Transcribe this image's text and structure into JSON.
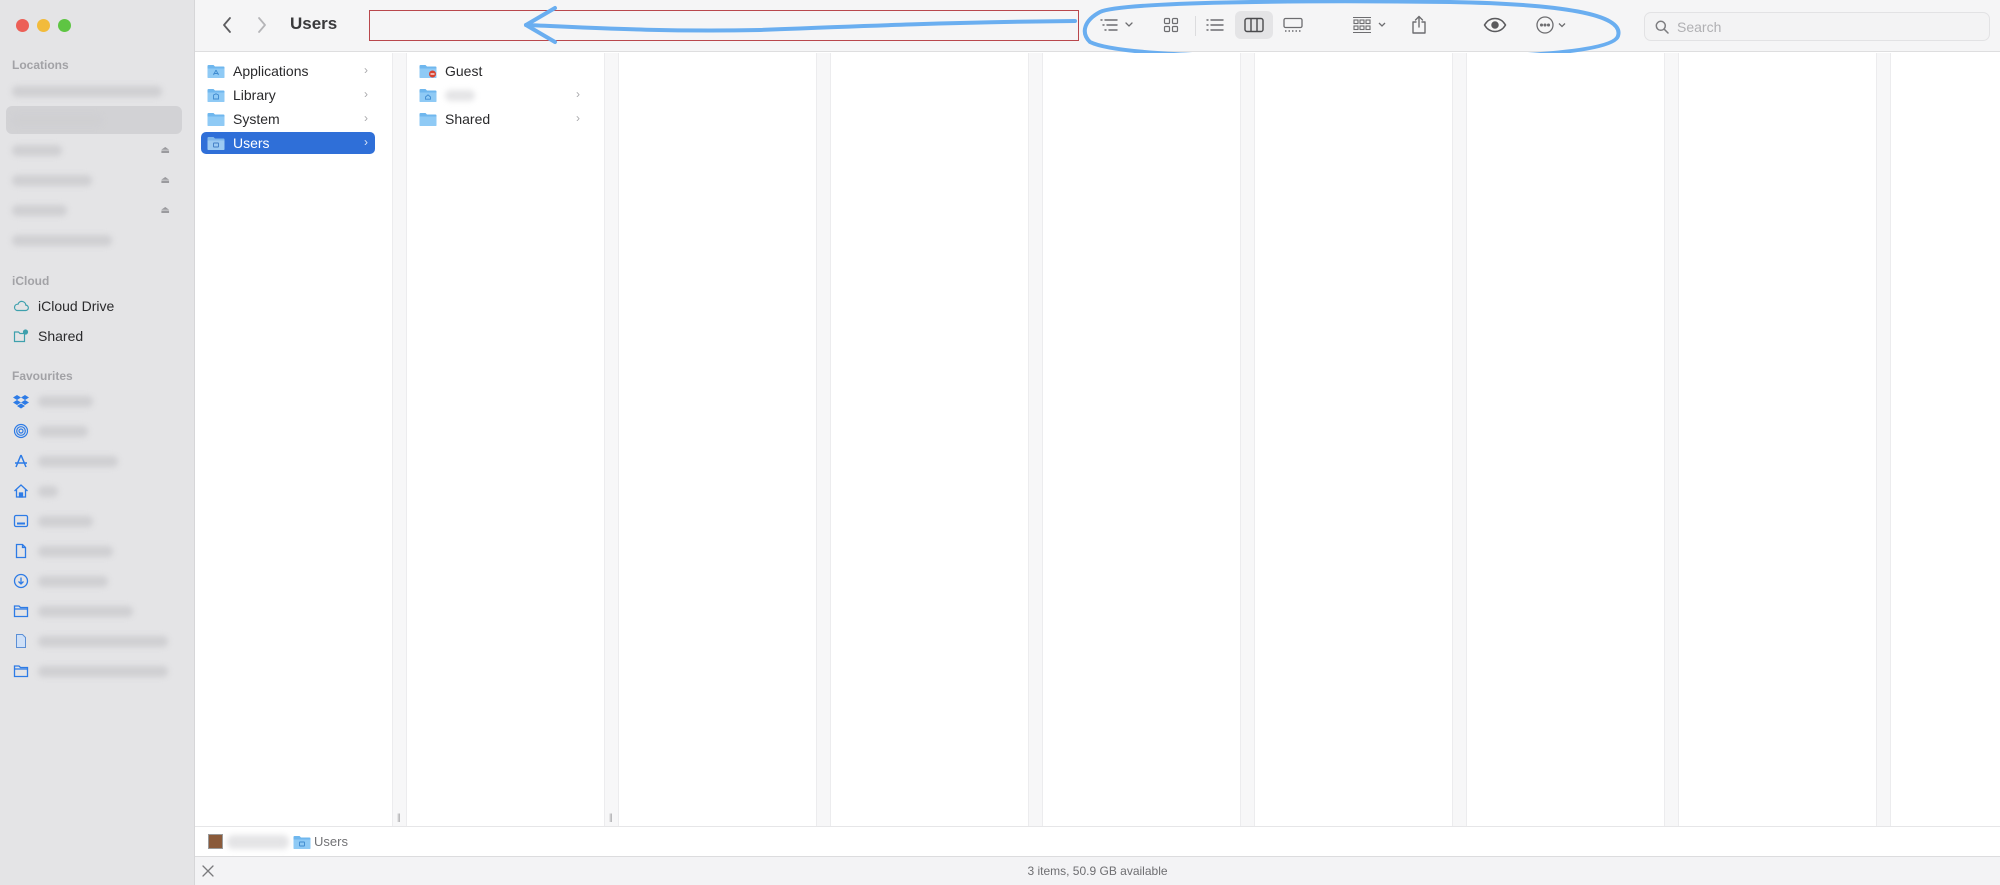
{
  "window": {
    "title": "Users",
    "traffic_lights": [
      "close",
      "minimize",
      "maximize"
    ]
  },
  "sidebar": {
    "sections": [
      {
        "label": "Locations",
        "items": [
          {
            "label": "",
            "icon": "drive-icon",
            "blurred": true,
            "eject": false,
            "selected": false
          },
          {
            "label": "",
            "icon": "drive-icon",
            "blurred": true,
            "eject": false,
            "selected": true
          },
          {
            "label": "",
            "icon": "drive-icon",
            "blurred": true,
            "eject": true,
            "selected": false
          },
          {
            "label": "",
            "icon": "drive-icon",
            "blurred": true,
            "eject": true,
            "selected": false
          },
          {
            "label": "",
            "icon": "drive-icon",
            "blurred": true,
            "eject": true,
            "selected": false
          },
          {
            "label": "",
            "icon": "network-icon",
            "blurred": true,
            "eject": false,
            "selected": false
          }
        ]
      },
      {
        "label": "iCloud",
        "items": [
          {
            "label": "iCloud Drive",
            "icon": "cloud-icon"
          },
          {
            "label": "Shared",
            "icon": "shared-folder-icon"
          }
        ]
      },
      {
        "label": "Favourites",
        "items": [
          {
            "label": "",
            "icon": "dropbox-icon",
            "blurred": true
          },
          {
            "label": "",
            "icon": "airdrop-icon",
            "blurred": true
          },
          {
            "label": "",
            "icon": "applications-icon",
            "blurred": true
          },
          {
            "label": "",
            "icon": "home-icon",
            "blurred": true
          },
          {
            "label": "",
            "icon": "desktop-icon",
            "blurred": true
          },
          {
            "label": "",
            "icon": "document-icon",
            "blurred": true
          },
          {
            "label": "",
            "icon": "downloads-icon",
            "blurred": true
          },
          {
            "label": "",
            "icon": "folder-icon",
            "blurred": true
          },
          {
            "label": "",
            "icon": "file-icon",
            "blurred": true
          },
          {
            "label": "",
            "icon": "folder-icon",
            "blurred": true
          }
        ]
      }
    ]
  },
  "toolbar": {
    "back_icon": "chevron-left-icon",
    "forward_icon": "chevron-right-icon",
    "title": "Users",
    "buttons": [
      {
        "name": "sort-menu-button",
        "icon": "list-sort-icon",
        "has_menu": true
      },
      {
        "name": "icon-view-button",
        "icon": "grid-icon"
      },
      {
        "name": "list-view-button",
        "icon": "list-icon"
      },
      {
        "name": "column-view-button",
        "icon": "columns-icon",
        "active": true
      },
      {
        "name": "gallery-view-button",
        "icon": "gallery-icon"
      },
      {
        "name": "group-menu-button",
        "icon": "group-icon",
        "has_menu": true
      },
      {
        "name": "share-button",
        "icon": "share-icon"
      },
      {
        "name": "quicklook-button",
        "icon": "eye-icon"
      },
      {
        "name": "more-actions-button",
        "icon": "ellipsis-circle-icon",
        "has_menu": true
      }
    ],
    "search": {
      "placeholder": "Search",
      "value": ""
    }
  },
  "annotation": {
    "box_color": "#b9474c",
    "pen_color": "#6aaef0"
  },
  "columns": [
    {
      "items": [
        {
          "label": "Applications",
          "icon": "applications-folder-icon",
          "has_children": true,
          "selected": false
        },
        {
          "label": "Library",
          "icon": "library-folder-icon",
          "has_children": true,
          "selected": false
        },
        {
          "label": "System",
          "icon": "system-folder-icon",
          "has_children": true,
          "selected": false
        },
        {
          "label": "Users",
          "icon": "users-folder-icon",
          "has_children": true,
          "selected": true
        }
      ]
    },
    {
      "items": [
        {
          "label": "Guest",
          "icon": "guest-folder-icon",
          "has_children": false,
          "badge": "no-entry"
        },
        {
          "label": "",
          "icon": "home-folder-icon",
          "has_children": true,
          "blurred": true
        },
        {
          "label": "Shared",
          "icon": "folder-icon",
          "has_children": true
        }
      ]
    },
    {
      "items": []
    },
    {
      "items": []
    },
    {
      "items": []
    },
    {
      "items": []
    },
    {
      "items": []
    },
    {
      "items": []
    }
  ],
  "pathbar": {
    "segments": [
      {
        "label": "",
        "icon": "hard-drive-icon",
        "blurred": true
      },
      {
        "label": "Users",
        "icon": "users-folder-icon"
      }
    ]
  },
  "statusbar": {
    "text": "3 items, 50.9 GB available"
  },
  "colors": {
    "selection": "#2f6fd8",
    "sidebar_icon": "#2d7be6",
    "folder": "#6fb7ee"
  }
}
